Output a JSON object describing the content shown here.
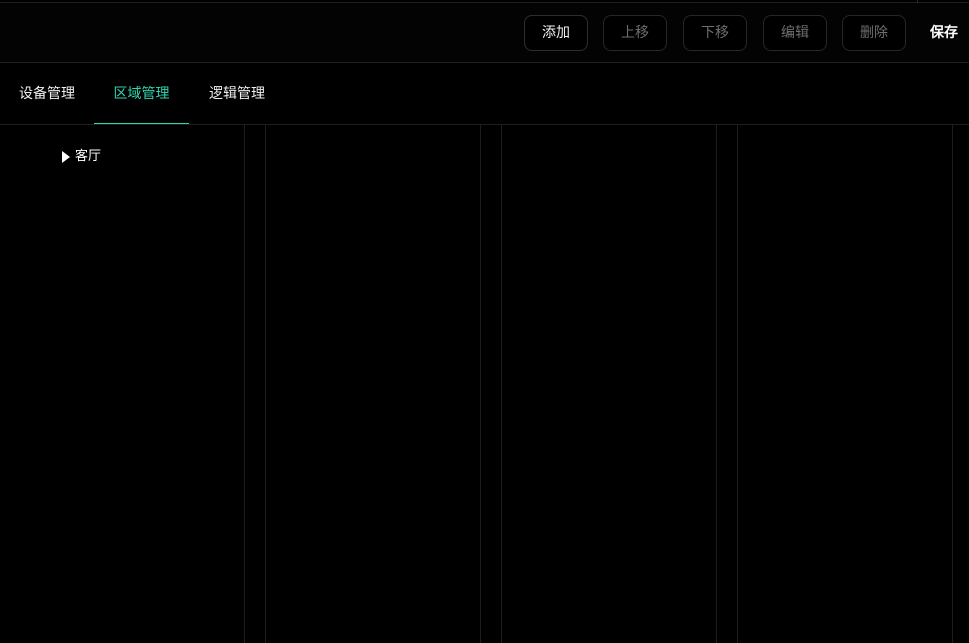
{
  "toolbar": {
    "add": "添加",
    "move_up": "上移",
    "move_down": "下移",
    "edit": "编辑",
    "delete": "删除",
    "save": "保存"
  },
  "tabs": [
    {
      "label": "设备管理"
    },
    {
      "label": "区域管理"
    },
    {
      "label": "逻辑管理"
    }
  ],
  "active_tab": "区域管理",
  "tree": {
    "items": [
      {
        "label": "客厅",
        "expanded": false
      }
    ]
  },
  "colors": {
    "background": "#000000",
    "accent": "#2fd5b0",
    "text": "#ffffff",
    "disabled_text": "#6e6e6e",
    "border": "#262626"
  },
  "icons": {
    "tree_toggle": "caret-right-icon"
  }
}
